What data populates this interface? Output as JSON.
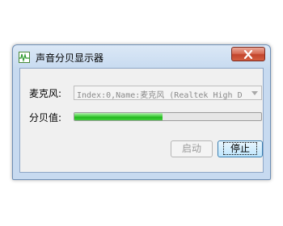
{
  "window": {
    "title": "声音分贝显示器"
  },
  "form": {
    "mic_label": "麦克风:",
    "mic_value": "Index:0,Name:麦克风 (Realtek High D",
    "db_label": "分贝值:",
    "db_level": 0.47
  },
  "buttons": {
    "start_label": "启动",
    "stop_label": "停止"
  }
}
